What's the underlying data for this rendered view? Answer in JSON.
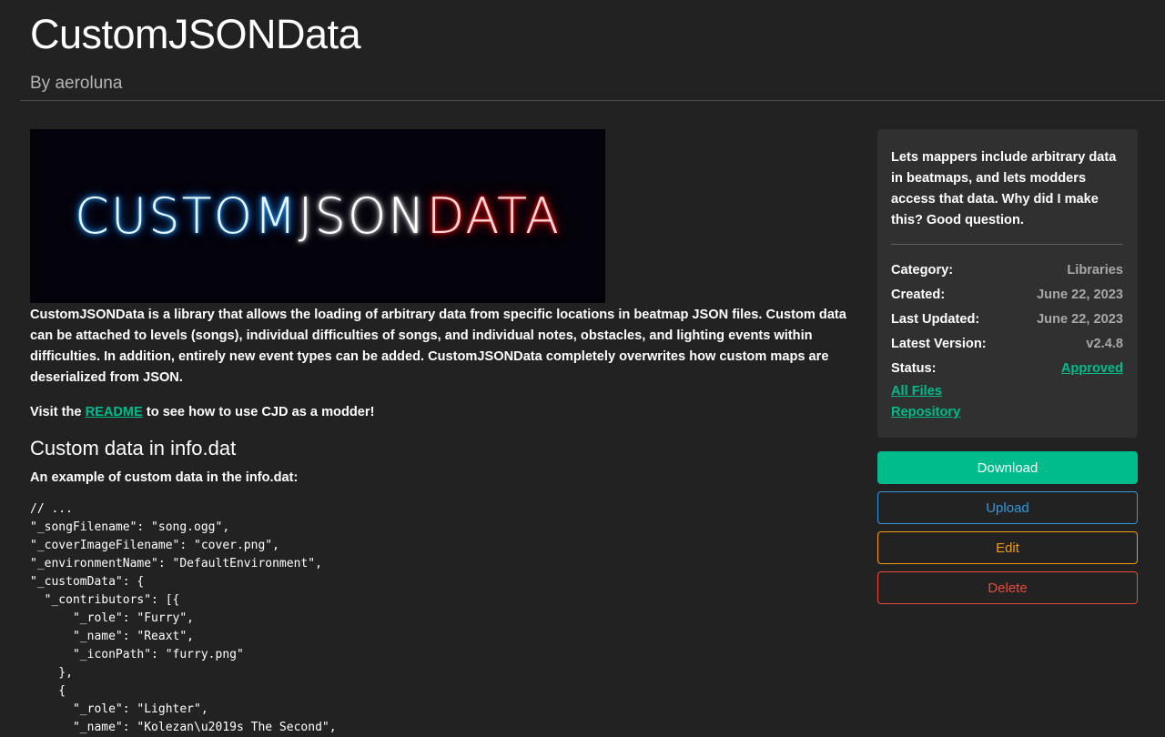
{
  "header": {
    "title": "CustomJSONData",
    "byline": "By aeroluna"
  },
  "banner": {
    "alt": "CUSTOMJSONDATA logo",
    "part_blue": "CUSTOM",
    "part_white": "JSON",
    "part_red": "DATA"
  },
  "main": {
    "description": "CustomJSONData is a library that allows the loading of arbitrary data from specific locations in beatmap JSON files. Custom data can be attached to levels (songs), individual difficulties of songs, and individual notes, obstacles, and lighting events within difficulties. In addition, entirely new event types can be added. CustomJSONData completely overwrites how custom maps are deserialized from JSON.",
    "readme_prefix": "Visit the ",
    "readme_link": "README",
    "readme_suffix": " to see how to use CJD as a modder!",
    "section_heading": "Custom data in info.dat",
    "section_sub": "An example of custom data in the info.dat:",
    "code_lines": [
      "// ...",
      "\"_songFilename\": \"song.ogg\",",
      "\"_coverImageFilename\": \"cover.png\",",
      "\"_environmentName\": \"DefaultEnvironment\",",
      "\"_customData\": {",
      "  \"_contributors\": [{",
      "      \"_role\": \"Furry\",",
      "      \"_name\": \"Reaxt\",",
      "      \"_iconPath\": \"furry.png\"",
      "    },",
      "    {",
      "      \"_role\": \"Lighter\",",
      "      \"_name\": \"Kolezan\\u2019s The Second\","
    ]
  },
  "sidebar": {
    "summary": "Lets mappers include arbitrary data in beatmaps, and lets modders access that data. Why did I make this? Good question.",
    "meta": [
      {
        "label": "Category:",
        "value": "Libraries"
      },
      {
        "label": "Created:",
        "value": "June 22, 2023"
      },
      {
        "label": "Last Updated:",
        "value": "June 22, 2023"
      },
      {
        "label": "Latest Version:",
        "value": "v2.4.8"
      },
      {
        "label": "Status:",
        "value": "Approved"
      }
    ],
    "links": {
      "all_files": "All Files",
      "repository": "Repository"
    },
    "buttons": {
      "download": "Download",
      "upload": "Upload",
      "edit": "Edit",
      "delete": "Delete"
    }
  },
  "colors": {
    "background": "#222222",
    "card": "#303030",
    "accent_green": "#00bc8c",
    "info_blue": "#3498db",
    "warning_orange": "#f39c12",
    "danger_red": "#e74c3c"
  }
}
